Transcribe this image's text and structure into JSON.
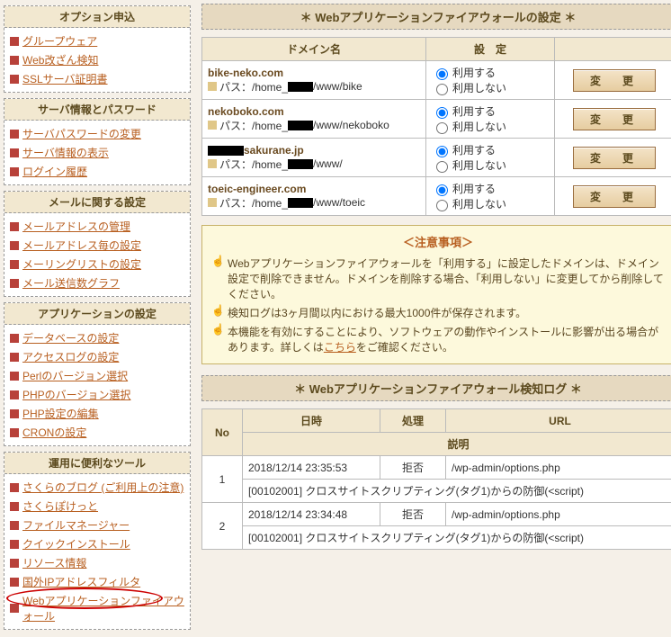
{
  "sidebar": {
    "panels": [
      {
        "title": "オプション申込",
        "items": [
          "グループウェア",
          "Web改ざん検知",
          "SSLサーバ証明書"
        ]
      },
      {
        "title": "サーバ情報とパスワード",
        "items": [
          "サーバパスワードの変更",
          "サーバ情報の表示",
          "ログイン履歴"
        ]
      },
      {
        "title": "メールに関する設定",
        "items": [
          "メールアドレスの管理",
          "メールアドレス毎の設定",
          "メーリングリストの設定",
          "メール送信数グラフ"
        ]
      },
      {
        "title": "アプリケーションの設定",
        "items": [
          "データベースの設定",
          "アクセスログの設定",
          "Perlのバージョン選択",
          "PHPのバージョン選択",
          "PHP設定の編集",
          "CRONの設定"
        ]
      },
      {
        "title": "運用に便利なツール",
        "items": [
          "さくらのブログ (ご利用上の注意)",
          "さくらぽけっと",
          "ファイルマネージャー",
          "クイックインストール",
          "リソース情報",
          "国外IPアドレスフィルタ",
          "Webアプリケーションファイアウォール"
        ],
        "highlight_index": 6
      }
    ]
  },
  "waf": {
    "title": "＊ Webアプリケーションファイアウォールの設定 ＊",
    "col_domain": "ドメイン名",
    "col_setting": "設　定",
    "path_label": "パス：",
    "opt_use": "利用する",
    "opt_notuse": "利用しない",
    "btn": "変　更",
    "rows": [
      {
        "domain": "bike-neko.com",
        "path_pre": "/home_",
        "path_post": "/www/bike",
        "mask_pre": true
      },
      {
        "domain": "nekoboko.com",
        "path_pre": "/home_",
        "path_post": "/www/nekoboko",
        "mask_pre": true
      },
      {
        "domain": "sakurane.jp",
        "path_pre": "/home_",
        "path_post": "/www/",
        "mask_domain": true,
        "mask_pre": true
      },
      {
        "domain": "toeic-engineer.com",
        "path_pre": "/home_",
        "path_post": "/www/toeic",
        "mask_pre": true
      }
    ]
  },
  "notice": {
    "title": "＜注意事項＞",
    "items": [
      "Webアプリケーションファイアウォールを「利用する」に設定したドメインは、ドメイン設定で削除できません。ドメインを削除する場合、「利用しない」に変更してから削除してください。",
      "検知ログは3ヶ月間以内における最大1000件が保存されます。",
      "本機能を有効にすることにより、ソフトウェアの動作やインストールに影響が出る場合があります。詳しくは",
      "をご確認ください。"
    ],
    "link": "こちら"
  },
  "log": {
    "title": "＊ Webアプリケーションファイアウォール検知ログ ＊",
    "col_no": "No",
    "col_dt": "日時",
    "col_action": "処理",
    "col_url": "URL",
    "col_desc": "説明",
    "rows": [
      {
        "no": "1",
        "dt": "2018/12/14 23:35:53",
        "action": "拒否",
        "url": "/wp-admin/options.php",
        "desc": "[00102001] クロスサイトスクリプティング(タグ1)からの防御(<script)"
      },
      {
        "no": "2",
        "dt": "2018/12/14 23:34:48",
        "action": "拒否",
        "url": "/wp-admin/options.php",
        "desc": "[00102001] クロスサイトスクリプティング(タグ1)からの防御(<script)"
      }
    ]
  }
}
